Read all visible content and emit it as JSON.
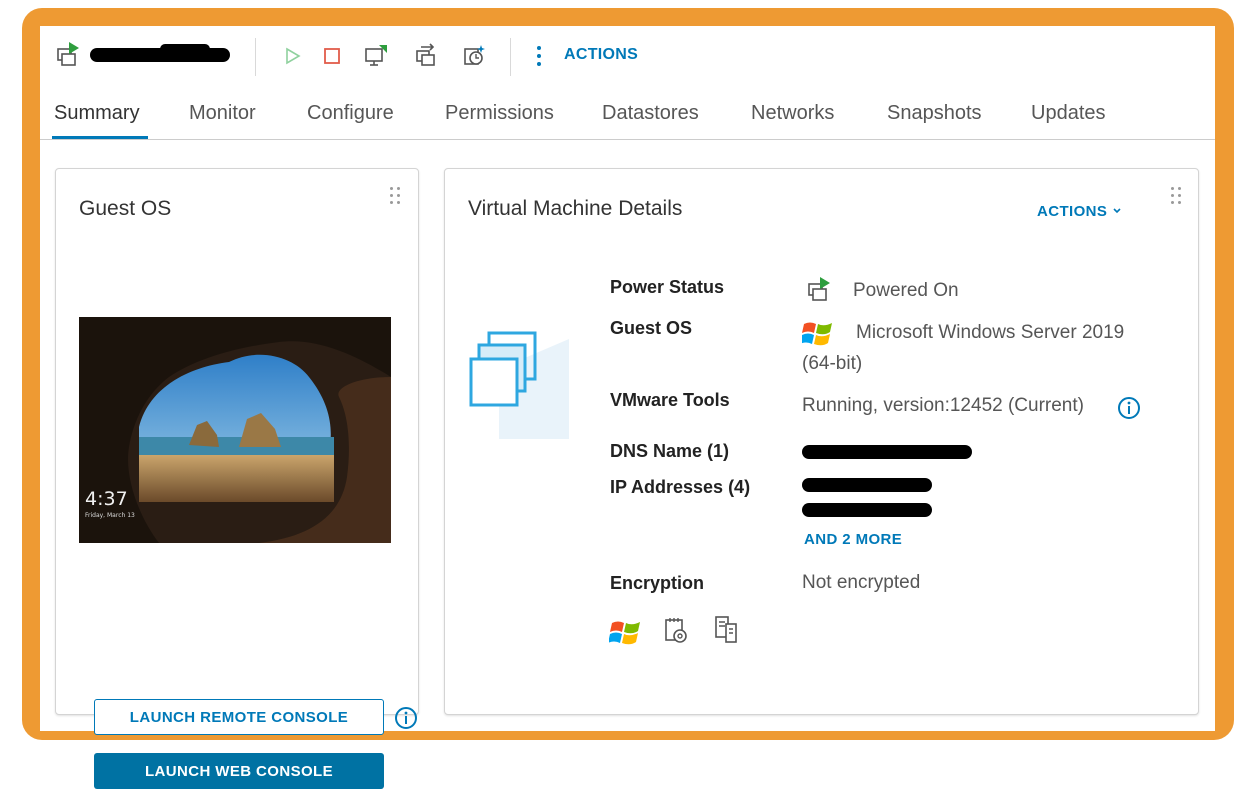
{
  "toolbar": {
    "vm_icon": "vm-powered-on-icon",
    "vm_name_redacted": "redacted-vm-name",
    "buttons": [
      {
        "icon": "power-on-icon"
      },
      {
        "icon": "power-off-icon"
      },
      {
        "icon": "launch-console-icon"
      },
      {
        "icon": "migrate-icon"
      },
      {
        "icon": "snapshot-icon"
      }
    ],
    "actions_label": "ACTIONS"
  },
  "tabs": [
    "Summary",
    "Monitor",
    "Configure",
    "Permissions",
    "Datastores",
    "Networks",
    "Snapshots",
    "Updates"
  ],
  "active_tab": "Summary",
  "guest_os_card": {
    "title": "Guest OS",
    "console_time": "4:37",
    "console_date": "Friday, March 13",
    "launch_remote_label": "LAUNCH REMOTE CONSOLE",
    "launch_web_label": "LAUNCH WEB CONSOLE"
  },
  "vm_details": {
    "title": "Virtual Machine Details",
    "actions_label": "ACTIONS",
    "power_status_label": "Power Status",
    "power_status_value": "Powered On",
    "guest_os_label": "Guest OS",
    "guest_os_value_line1": "Microsoft Windows Server 2019",
    "guest_os_value_line2": "(64-bit)",
    "vmware_tools_label": "VMware Tools",
    "vmware_tools_value": "Running, version:12452 (Current)",
    "dns_name_label": "DNS Name (1)",
    "ip_addresses_label": "IP Addresses (4)",
    "more_link": "AND 2 MORE",
    "encryption_label": "Encryption",
    "encryption_value": "Not encrypted"
  },
  "colors": {
    "frame": "#ee9a33",
    "accent": "#0079b8",
    "button_primary": "#0072a3"
  }
}
